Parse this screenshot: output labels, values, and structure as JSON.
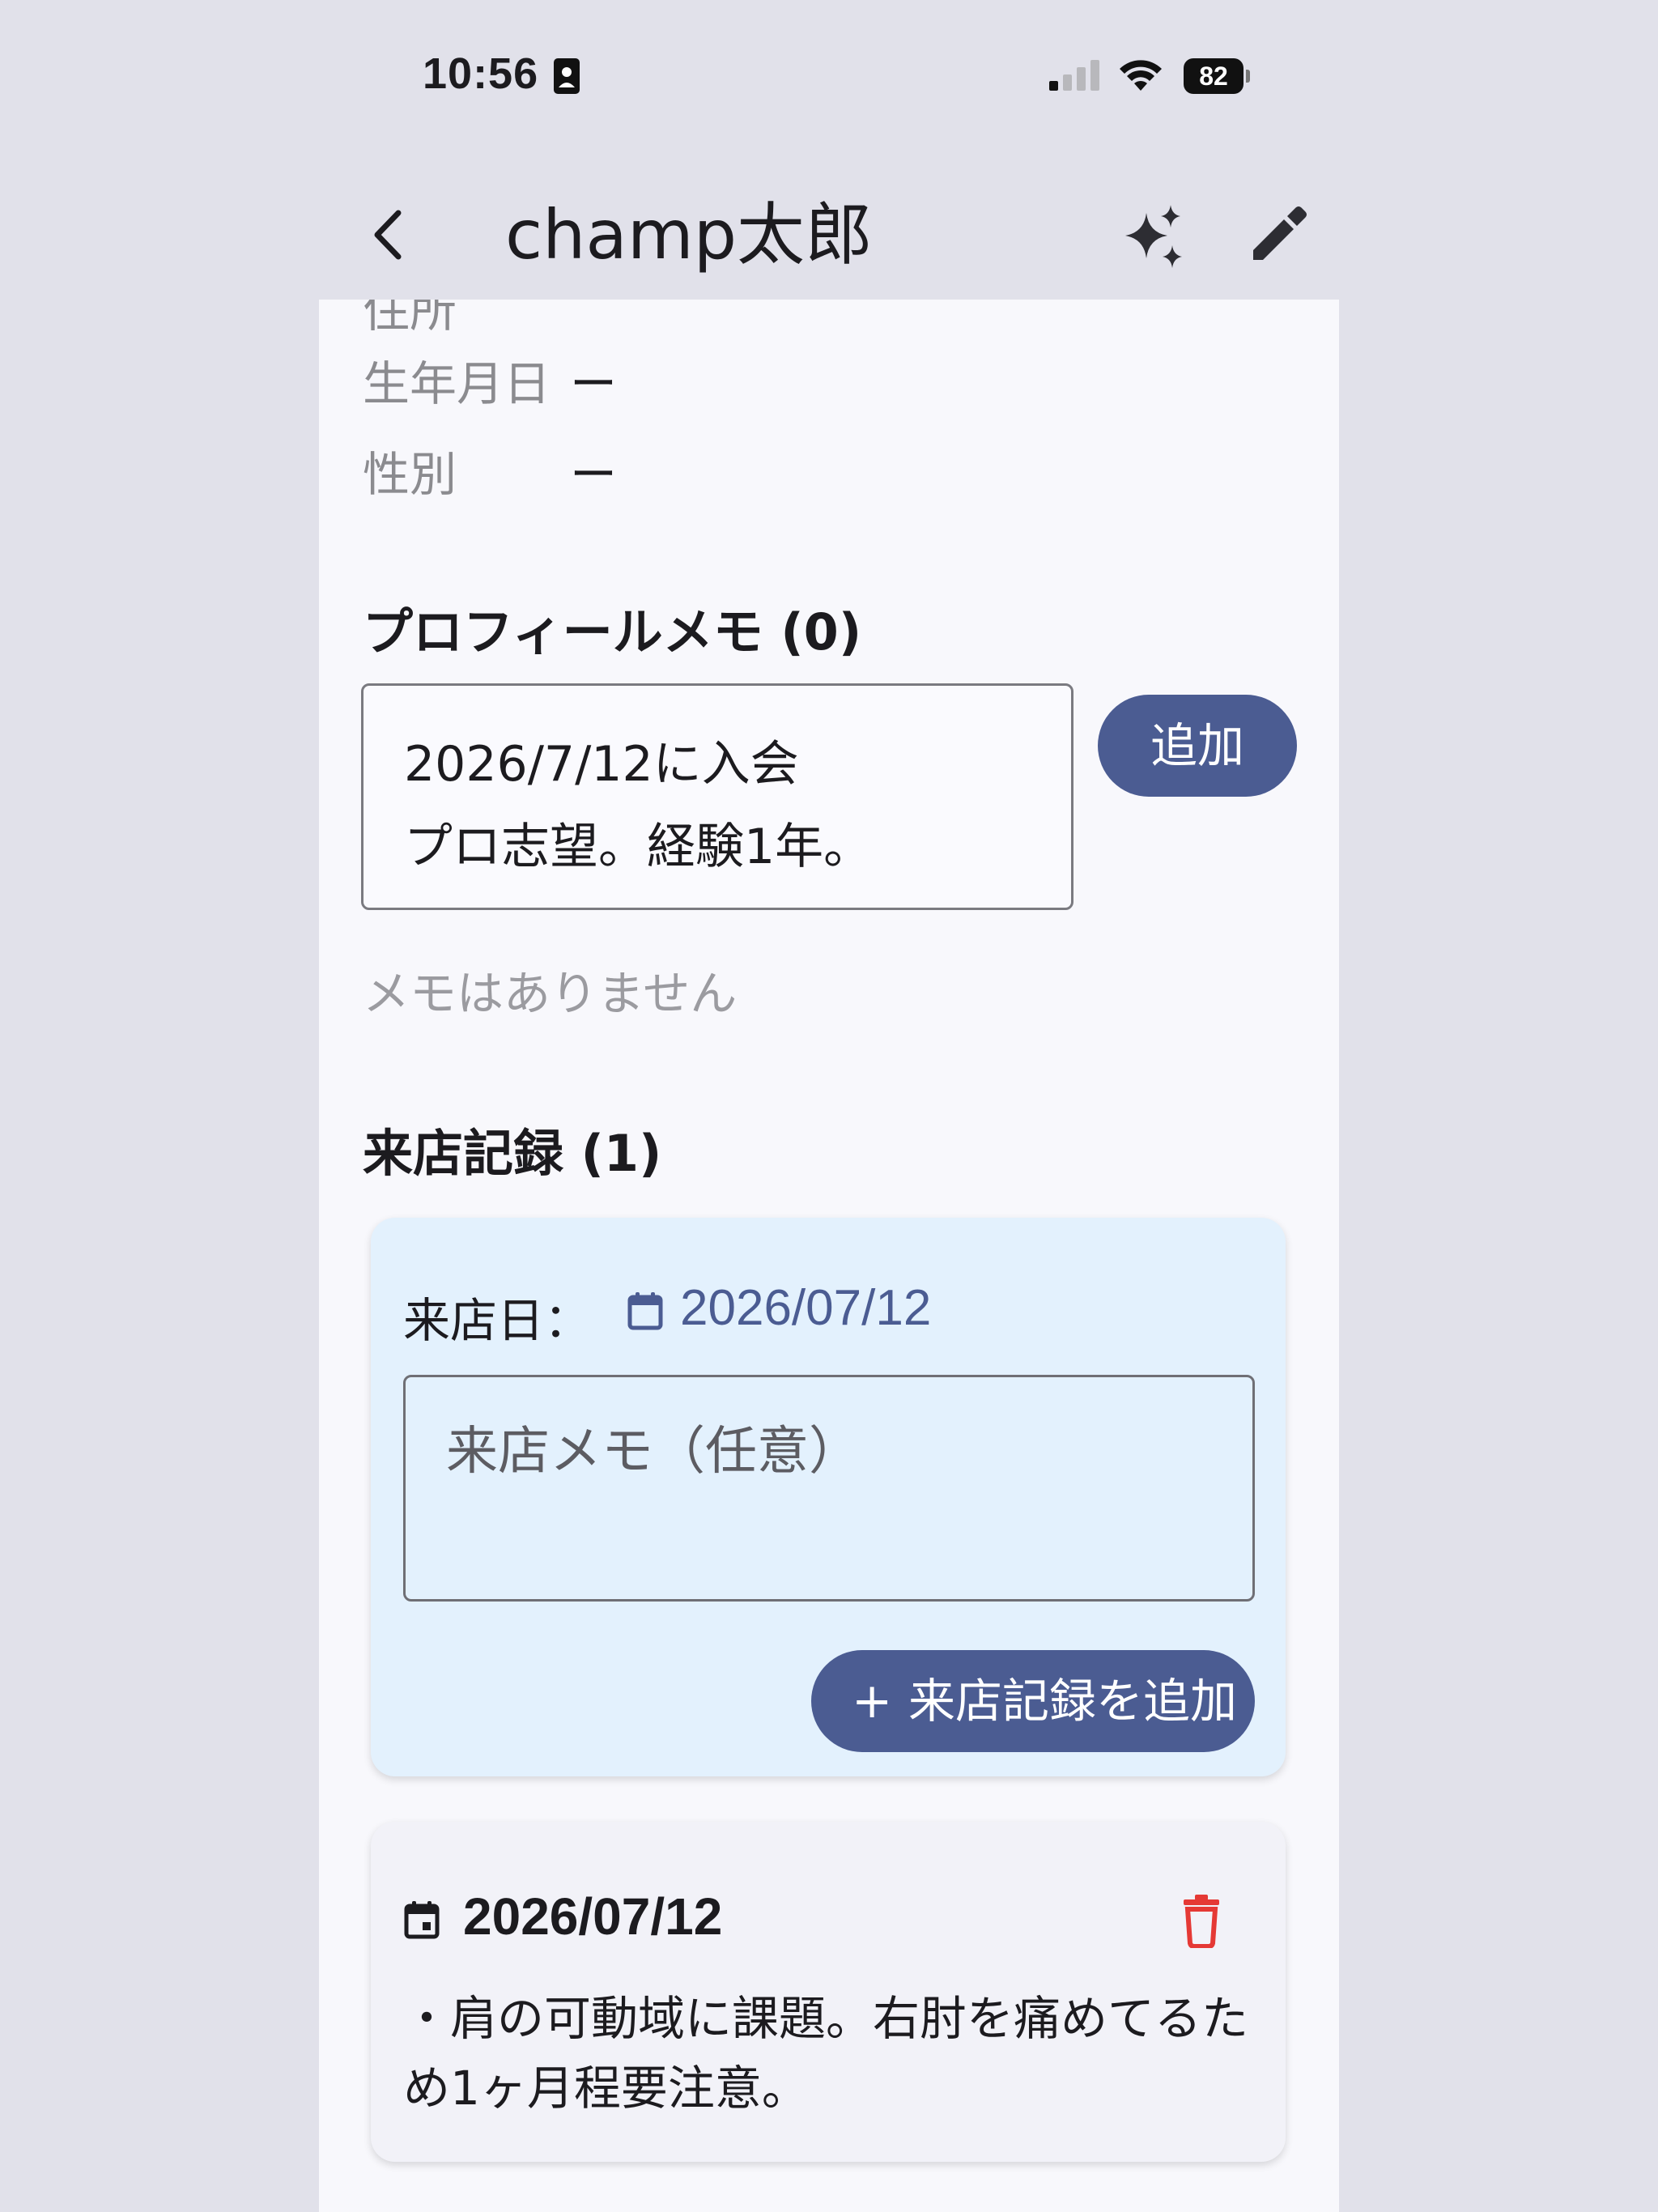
{
  "status_bar": {
    "time": "10:56",
    "battery": "82"
  },
  "app_bar": {
    "title": "champ太郎",
    "icons": [
      "back-arrow-icon",
      "sparkle-icon",
      "edit-pencil-icon"
    ]
  },
  "profile": {
    "clipped_label": "住所",
    "fields": [
      {
        "label": "生年月日",
        "value": "ー"
      },
      {
        "label": "性別",
        "value": "ー"
      }
    ]
  },
  "profile_memo": {
    "title": "プロフィールメモ (0)",
    "input_value": "2026/7/12に入会\nプロ志望。経験1年。",
    "add_label": "追加",
    "empty_text": "メモはありません"
  },
  "visits": {
    "title": "来店記録 (1)",
    "form": {
      "date_label": "来店日：",
      "date_value": "2026/07/12",
      "memo_placeholder": "来店メモ（任意）",
      "add_label": "来店記録を追加"
    },
    "records": [
      {
        "date": "2026/07/12",
        "memo": "・肩の可動域に課題。右肘を痛めてるため1ヶ月程要注意。"
      }
    ]
  },
  "colors": {
    "primary": "#4b5c92",
    "delete": "#e53935",
    "form_card_bg": "#e3f1fd",
    "record_card_bg": "#f2f2f8"
  }
}
